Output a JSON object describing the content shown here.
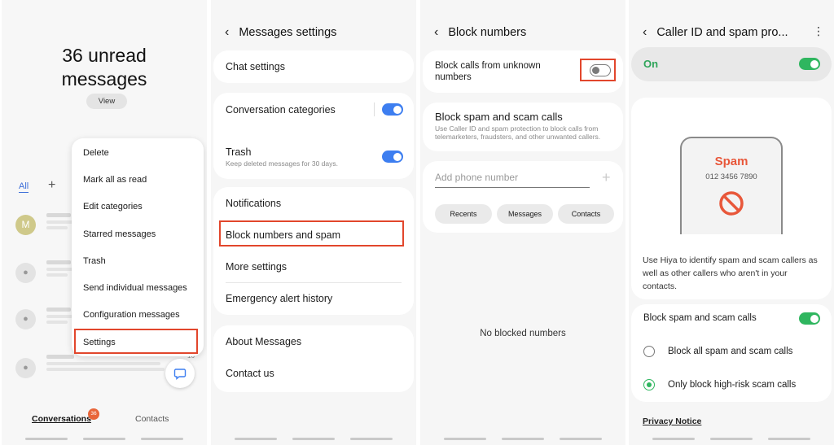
{
  "p1": {
    "headline_1": "36 unread",
    "headline_2": "messages",
    "view_button": "View",
    "tab_all": "All",
    "add_tab": "+",
    "avatar_letter": "M",
    "bubble_count": "16",
    "menu": [
      "Delete",
      "Mark all as read",
      "Edit categories",
      "Starred messages",
      "Trash",
      "Send individual messages",
      "Configuration messages",
      "Settings"
    ],
    "bottom_tabs": {
      "conversations": "Conversations",
      "badge": "36",
      "contacts": "Contacts"
    }
  },
  "p2": {
    "title": "Messages settings",
    "chat_settings": "Chat settings",
    "conversation_categories": "Conversation categories",
    "trash": "Trash",
    "trash_sub": "Keep deleted messages for 30 days.",
    "notifications": "Notifications",
    "block_numbers": "Block numbers and spam",
    "more_settings": "More settings",
    "emergency": "Emergency alert history",
    "about": "About Messages",
    "contact": "Contact us"
  },
  "p3": {
    "title": "Block numbers",
    "block_unknown": "Block calls from unknown numbers",
    "block_spam": "Block spam and scam calls",
    "block_spam_sub": "Use Caller ID and spam protection to block calls from telemarketers, fraudsters, and other unwanted callers.",
    "add_phone_placeholder": "Add phone number",
    "chip_recents": "Recents",
    "chip_messages": "Messages",
    "chip_contacts": "Contacts",
    "empty": "No blocked numbers"
  },
  "p4": {
    "title": "Caller ID and spam pro...",
    "on_label": "On",
    "spam_title": "Spam",
    "spam_number": "012 3456 7890",
    "description": "Use Hiya to identify spam and scam callers as well as other callers who aren't in your contacts.",
    "block_spam": "Block spam and scam calls",
    "radio_all": "Block all spam and scam calls",
    "radio_high": "Only block high-risk scam calls",
    "privacy": "Privacy Notice"
  },
  "colors": {
    "accent_blue": "#3d7ef0",
    "green": "#2fb65f",
    "highlight_red": "#e2462c",
    "spam_red": "#e8573a",
    "badge_orange": "#e8663a"
  }
}
